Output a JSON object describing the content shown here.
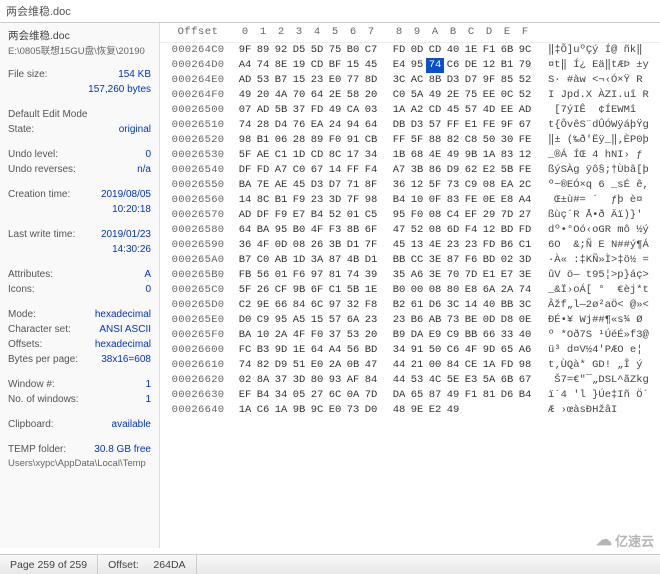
{
  "title": "两会维稳.doc",
  "sidebar": {
    "filename": "两会维稳.doc",
    "filepath": "E:\\0805联想15GU盘\\恢复\\20190",
    "filesize_label": "File size:",
    "filesize_kb": "154 KB",
    "filesize_bytes": "157,260 bytes",
    "editmode_header": "Default Edit Mode",
    "state_label": "State:",
    "state_value": "original",
    "undo_level_label": "Undo level:",
    "undo_level_value": "0",
    "undo_rev_label": "Undo reverses:",
    "undo_rev_value": "n/a",
    "ctime_label": "Creation time:",
    "ctime_date": "2019/08/05",
    "ctime_time": "10:20:18",
    "mtime_label": "Last write time:",
    "mtime_date": "2019/01/23",
    "mtime_time": "14:30:26",
    "attr_label": "Attributes:",
    "attr_value": "A",
    "icons_label": "Icons:",
    "icons_value": "0",
    "mode_label": "Mode:",
    "mode_value": "hexadecimal",
    "charset_label": "Character set:",
    "charset_value": "ANSI ASCII",
    "offsets_label": "Offsets:",
    "offsets_value": "hexadecimal",
    "bpp_label": "Bytes per page:",
    "bpp_value": "38x16=608",
    "window_label": "Window #:",
    "window_value": "1",
    "numwin_label": "No. of windows:",
    "numwin_value": "1",
    "clip_label": "Clipboard:",
    "clip_value": "available",
    "temp_label": "TEMP folder:",
    "temp_value": "30.8 GB free",
    "temp_path": "Users\\xypc\\AppData\\Local\\Temp"
  },
  "header": {
    "offset": "Offset",
    "cols": [
      "0",
      "1",
      "2",
      "3",
      "4",
      "5",
      "6",
      "7",
      "8",
      "9",
      "A",
      "B",
      "C",
      "D",
      "E",
      "F"
    ]
  },
  "rows": [
    {
      "off": "000264C0",
      "hex": [
        "9F",
        "89",
        "92",
        "D5",
        "5D",
        "75",
        "B0",
        "C7",
        "FD",
        "0D",
        "CD",
        "40",
        "1E",
        "F1",
        "6B",
        "9C"
      ],
      "asc": "‖‡Õ]uºÇý Í@ ñk‖"
    },
    {
      "off": "000264D0",
      "hex": [
        "A4",
        "74",
        "8E",
        "19",
        "CD",
        "BF",
        "15",
        "45",
        "E4",
        "95",
        "74",
        "C6",
        "DE",
        "12",
        "B1",
        "79"
      ],
      "asc": "¤t‖ Í¿ Eä‖tÆÞ ±y"
    },
    {
      "off": "000264E0",
      "hex": [
        "AD",
        "53",
        "B7",
        "15",
        "23",
        "E0",
        "77",
        "8D",
        "3C",
        "AC",
        "8B",
        "D3",
        "D7",
        "9F",
        "85",
        "52"
      ],
      "asc": "­S· #àw <¬‹Ó×Ÿ R"
    },
    {
      "off": "000264F0",
      "hex": [
        "49",
        "20",
        "4A",
        "70",
        "64",
        "2E",
        "58",
        "20",
        "C0",
        "5A",
        "49",
        "2E",
        "75",
        "EE",
        "0C",
        "52"
      ],
      "asc": "I Jpd.X ÀZI.uî R"
    },
    {
      "off": "00026500",
      "hex": [
        "07",
        "AD",
        "5B",
        "37",
        "FD",
        "49",
        "CA",
        "03",
        "1A",
        "A2",
        "CD",
        "45",
        "57",
        "4D",
        "EE",
        "AD"
      ],
      "asc": " ­[7ýIÊ  ¢ÍEWMî­"
    },
    {
      "off": "00026510",
      "hex": [
        "74",
        "28",
        "D4",
        "76",
        "EA",
        "24",
        "94",
        "64",
        "DB",
        "D3",
        "57",
        "FF",
        "E1",
        "FE",
        "9F",
        "67"
      ],
      "asc": "t{ÔvêS¨dÛÓWÿáþŸg"
    },
    {
      "off": "00026520",
      "hex": [
        "98",
        "B1",
        "06",
        "28",
        "89",
        "F0",
        "91",
        "CB",
        "FF",
        "5F",
        "88",
        "82",
        "C8",
        "50",
        "30",
        "FE"
      ],
      "asc": "‖± (‰ð'Ëÿ_‖‚ÈP0þ"
    },
    {
      "off": "00026530",
      "hex": [
        "5F",
        "AE",
        "C1",
        "1D",
        "CD",
        "8C",
        "17",
        "34",
        "1B",
        "68",
        "4E",
        "49",
        "9B",
        "1A",
        "83",
        "12"
      ],
      "asc": "_®Á ÍŒ 4 hNI› ƒ "
    },
    {
      "off": "00026540",
      "hex": [
        "DF",
        "FD",
        "A7",
        "C0",
        "67",
        "14",
        "FF",
        "F4",
        "A7",
        "3B",
        "86",
        "D9",
        "62",
        "E2",
        "5B",
        "FE"
      ],
      "asc": "ßýSÀg ÿô§;†Ùbâ[þ"
    },
    {
      "off": "00026550",
      "hex": [
        "BA",
        "7E",
        "AE",
        "45",
        "D3",
        "D7",
        "71",
        "8F",
        "36",
        "12",
        "5F",
        "73",
        "C9",
        "08",
        "EA",
        "2C"
      ],
      "asc": "º~®EÓ×q 6 _sÉ ê,"
    },
    {
      "off": "00026560",
      "hex": [
        "14",
        "8C",
        "B1",
        "F9",
        "23",
        "3D",
        "7F",
        "98",
        "B4",
        "10",
        "0F",
        "83",
        "FE",
        "0E",
        "E8",
        "A4"
      ],
      "asc": " Œ±ù#= ´  ƒþ è¤"
    },
    {
      "off": "00026570",
      "hex": [
        "AD",
        "DF",
        "F9",
        "E7",
        "B4",
        "52",
        "01",
        "C5",
        "95",
        "F0",
        "08",
        "C4",
        "EF",
        "29",
        "7D",
        "27"
      ],
      "asc": "­ßùç´R Å•ð Äï)}'"
    },
    {
      "off": "00026580",
      "hex": [
        "64",
        "BA",
        "95",
        "B0",
        "4F",
        "F3",
        "8B",
        "6F",
        "47",
        "52",
        "08",
        "6D",
        "F4",
        "12",
        "BD",
        "FD"
      ],
      "asc": "dº•°Oó‹oGR mô ½ý"
    },
    {
      "off": "00026590",
      "hex": [
        "36",
        "4F",
        "0D",
        "08",
        "26",
        "3B",
        "D1",
        "7F",
        "45",
        "13",
        "4E",
        "23",
        "23",
        "FD",
        "B6",
        "C1"
      ],
      "asc": "6O  &;Ñ E N##ý¶Á"
    },
    {
      "off": "000265A0",
      "hex": [
        "B7",
        "C0",
        "AB",
        "1D",
        "3A",
        "87",
        "4B",
        "D1",
        "BB",
        "CC",
        "3E",
        "87",
        "F6",
        "BD",
        "02",
        "3D"
      ],
      "asc": "·À« :‡KÑ»Ì>‡ö½ ="
    },
    {
      "off": "000265B0",
      "hex": [
        "FB",
        "56",
        "01",
        "F6",
        "97",
        "81",
        "74",
        "39",
        "35",
        "A6",
        "3E",
        "70",
        "7D",
        "E1",
        "E7",
        "3E"
      ],
      "asc": "ûV ö— t95¦>p}áç>"
    },
    {
      "off": "000265C0",
      "hex": [
        "5F",
        "26",
        "CF",
        "9B",
        "6F",
        "C1",
        "5B",
        "1E",
        "B0",
        "00",
        "08",
        "80",
        "E8",
        "6A",
        "2A",
        "74"
      ],
      "asc": "_&Ï›oÁ[ °  €èj*t"
    },
    {
      "off": "000265D0",
      "hex": [
        "C2",
        "9E",
        "66",
        "84",
        "6C",
        "97",
        "32",
        "F8",
        "B2",
        "61",
        "D6",
        "3C",
        "14",
        "40",
        "BB",
        "3C"
      ],
      "asc": "Âžf„l—2ø²aÖ< @»<"
    },
    {
      "off": "000265E0",
      "hex": [
        "D0",
        "C9",
        "95",
        "A5",
        "15",
        "57",
        "6A",
        "23",
        "23",
        "B6",
        "AB",
        "73",
        "BE",
        "0D",
        "D8",
        "0E"
      ],
      "asc": "ÐÉ•¥ Wj##¶«s¾ Ø "
    },
    {
      "off": "000265F0",
      "hex": [
        "BA",
        "10",
        "2A",
        "4F",
        "F0",
        "37",
        "53",
        "20",
        "B9",
        "DA",
        "E9",
        "C9",
        "BB",
        "66",
        "33",
        "40"
      ],
      "asc": "º *Oð7S ¹ÚéÉ»f3@"
    },
    {
      "off": "00026600",
      "hex": [
        "FC",
        "B3",
        "9D",
        "1E",
        "64",
        "A4",
        "56",
        "BD",
        "34",
        "91",
        "50",
        "C6",
        "4F",
        "9D",
        "65",
        "A6"
      ],
      "asc": "ü³ d¤V½4'PÆO e¦"
    },
    {
      "off": "00026610",
      "hex": [
        "74",
        "82",
        "D9",
        "51",
        "E0",
        "2A",
        "0B",
        "47",
        "44",
        "21",
        "00",
        "84",
        "CE",
        "1A",
        "FD",
        "98"
      ],
      "asc": "t‚ÙQà* GD! „Î ý "
    },
    {
      "off": "00026620",
      "hex": [
        "02",
        "8A",
        "37",
        "3D",
        "80",
        "93",
        "AF",
        "84",
        "44",
        "53",
        "4C",
        "5E",
        "E3",
        "5A",
        "6B",
        "67"
      ],
      "asc": " Š7=€\"¯„DSL^ãZkg"
    },
    {
      "off": "00026630",
      "hex": [
        "EF",
        "B4",
        "34",
        "05",
        "27",
        "6C",
        "0A",
        "7D",
        "DA",
        "65",
        "87",
        "49",
        "F1",
        "81",
        "D6",
        "B4"
      ],
      "asc": "ï´4 'l }Úe‡Iñ Ö´"
    },
    {
      "off": "00026640",
      "hex": [
        "1A",
        "C6",
        "1A",
        "9B",
        "9C",
        "E0",
        "73",
        "D0",
        "48",
        "9E",
        "E2",
        "49",
        "",
        "",
        "",
        ""
      ],
      "asc": "Æ ›œàsÐHžâI"
    }
  ],
  "highlight": {
    "row": 1,
    "col": 10
  },
  "status": {
    "page": "Page 259 of 259",
    "offset_label": "Offset:",
    "offset_value": "264DA"
  },
  "watermark": "亿速云"
}
